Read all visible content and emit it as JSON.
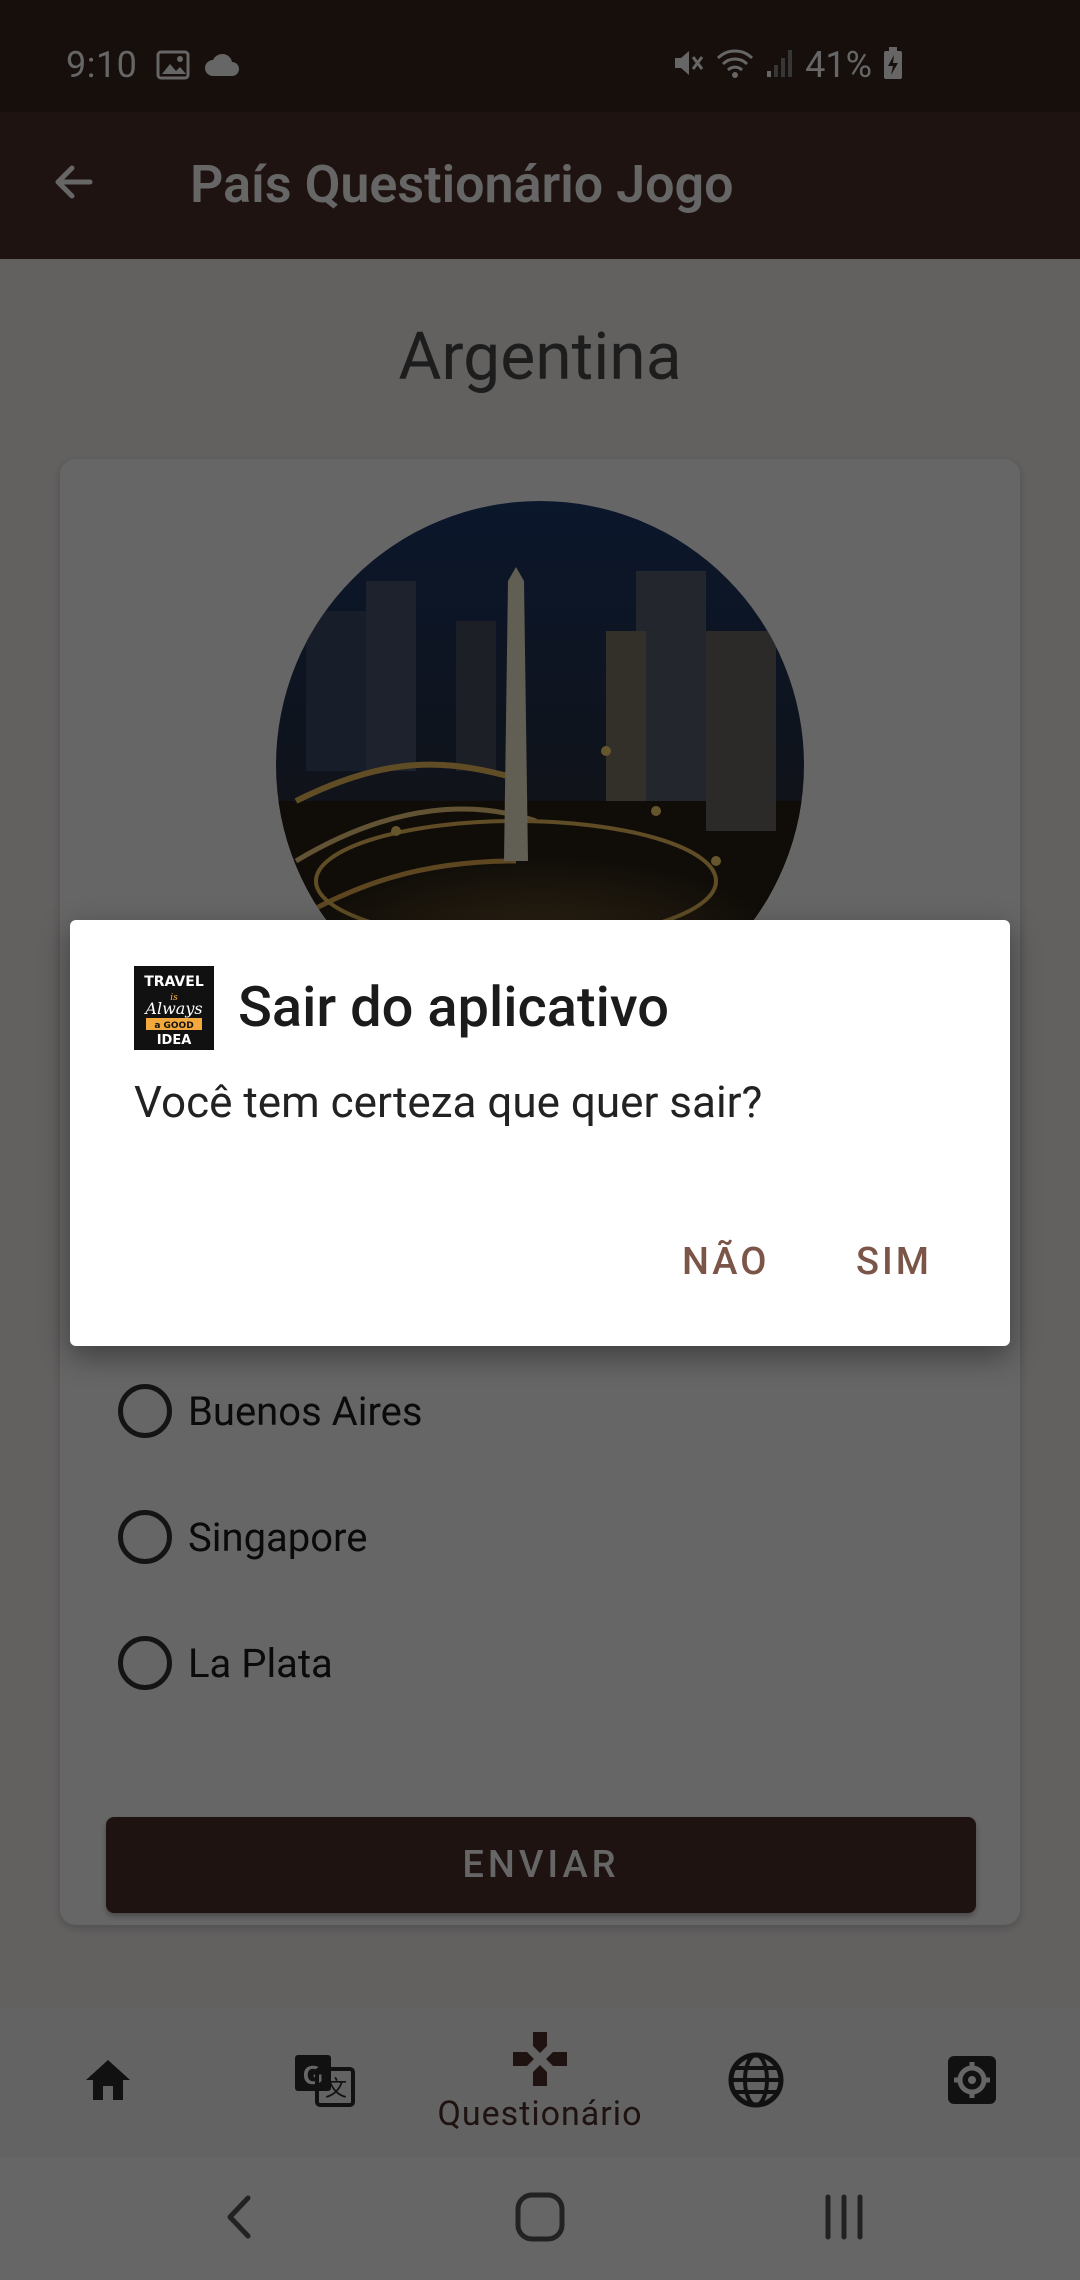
{
  "status_bar": {
    "time": "9:10",
    "battery": "41%",
    "left_icons": [
      "image-icon",
      "cloud-icon"
    ],
    "right_icons": [
      "mute-icon",
      "wifi-icon",
      "signal-icon",
      "battery-charging-icon"
    ]
  },
  "app_bar": {
    "title": "País Questionário Jogo",
    "back_icon": "arrow-back-icon"
  },
  "quiz": {
    "country": "Argentina",
    "options": [
      "Buenos Aires",
      "Singapore",
      "La Plata"
    ],
    "submit_label": "ENVIAR"
  },
  "bottom_nav": {
    "items": [
      {
        "icon": "home-icon",
        "label": ""
      },
      {
        "icon": "translate-icon",
        "label": ""
      },
      {
        "icon": "gamepad-icon",
        "label": "Questionário"
      },
      {
        "icon": "globe-icon",
        "label": ""
      },
      {
        "icon": "settings-icon",
        "label": ""
      }
    ]
  },
  "dialog": {
    "title": "Sair do aplicativo",
    "message": "Você tem certeza que quer sair?",
    "negative_label": "NÃO",
    "positive_label": "SIM",
    "logo_text": [
      "TRAVEL",
      "is",
      "Always",
      "a GOOD",
      "IDEA"
    ]
  },
  "colors": {
    "primary_dark": "#3a2720",
    "primary": "#4b3028",
    "dialog_button": "#7a5548"
  }
}
